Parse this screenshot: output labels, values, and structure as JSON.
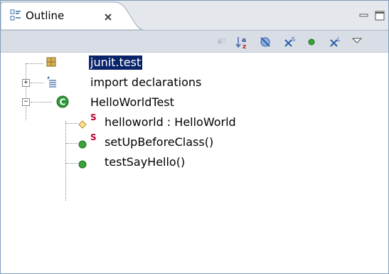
{
  "view": {
    "tab_title": "Outline",
    "icons": {
      "tab": "outline-icon",
      "close": "close-icon",
      "minimize": "minimize-icon",
      "maximize": "maximize-icon"
    }
  },
  "toolbar": {
    "items": [
      {
        "name": "hide-fields-icon"
      },
      {
        "name": "sort-alphabetically-icon"
      },
      {
        "name": "hide-fields-filter-icon"
      },
      {
        "name": "hide-static-members-icon"
      },
      {
        "name": "hide-non-public-members-icon"
      },
      {
        "name": "hide-local-types-icon"
      },
      {
        "name": "view-menu-icon"
      }
    ]
  },
  "tree": {
    "items": [
      {
        "label": "junit.test",
        "icon": "package-icon",
        "selected": true
      },
      {
        "label": "import declarations",
        "icon": "imports-icon",
        "expander": "+"
      },
      {
        "label": "HelloWorldTest",
        "icon": "class-icon",
        "expander": "−"
      },
      {
        "label": "helloworld : HelloWorld",
        "icon": "field-icon",
        "modifier": "S"
      },
      {
        "label": "setUpBeforeClass()",
        "icon": "public-method-icon",
        "modifier": "S"
      },
      {
        "label": "testSayHello()",
        "icon": "public-method-icon"
      }
    ]
  },
  "colors": {
    "selection": "#0a246a",
    "tab_bar": "#e4e7ec",
    "toolbar": "#d9dee6",
    "static_marker": "#c00030",
    "method_green": "#2e9a2e"
  }
}
